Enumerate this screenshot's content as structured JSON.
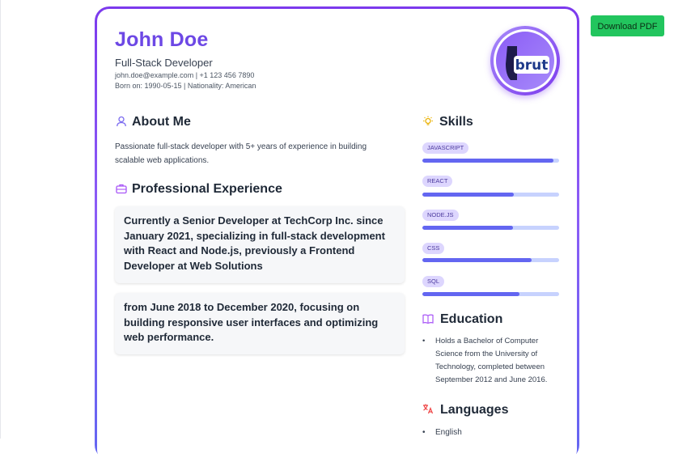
{
  "toolbar": {
    "download_label": "Download PDF"
  },
  "profile": {
    "name": "John Doe",
    "role": "Full-Stack Developer",
    "contact": "john.doe@example.com | +1 123 456 7890",
    "born": "Born on: 1990-05-15 | Nationality: American",
    "avatar_text": "brut"
  },
  "about": {
    "title": "About Me",
    "text": "Passionate full-stack developer with 5+ years of experience in building scalable web applications."
  },
  "experience": {
    "title": "Professional Experience",
    "items": [
      "Currently a Senior Developer at TechCorp Inc. since January 2021, specializing in full-stack development with React and Node.js, previously a Frontend Developer at Web Solutions",
      "from June 2018 to December 2020, focusing on building responsive user interfaces and optimizing web performance."
    ]
  },
  "skills": {
    "title": "Skills",
    "items": [
      {
        "name": "JavaScript",
        "level": 0.96
      },
      {
        "name": "React",
        "level": 0.67
      },
      {
        "name": "Node.js",
        "level": 0.66
      },
      {
        "name": "CSS",
        "level": 0.8
      },
      {
        "name": "SQL",
        "level": 0.71
      }
    ]
  },
  "education": {
    "title": "Education",
    "items": [
      "Holds a Bachelor of Computer Science from the University of Technology, completed between September 2012 and June 2016."
    ]
  },
  "languages": {
    "title": "Languages",
    "items": [
      "English"
    ]
  },
  "colors": {
    "accent": "#6d48e5",
    "card_border": "#7c3aed",
    "download_button": "#22c55e",
    "skill_fill": "#6366f1",
    "skill_track": "#c7d2fe",
    "skill_badge": "#ddd6fe"
  },
  "icons": {
    "about": "user-icon",
    "experience": "briefcase-icon",
    "skills": "lightbulb-icon",
    "education": "book-icon",
    "languages": "translate-icon"
  }
}
